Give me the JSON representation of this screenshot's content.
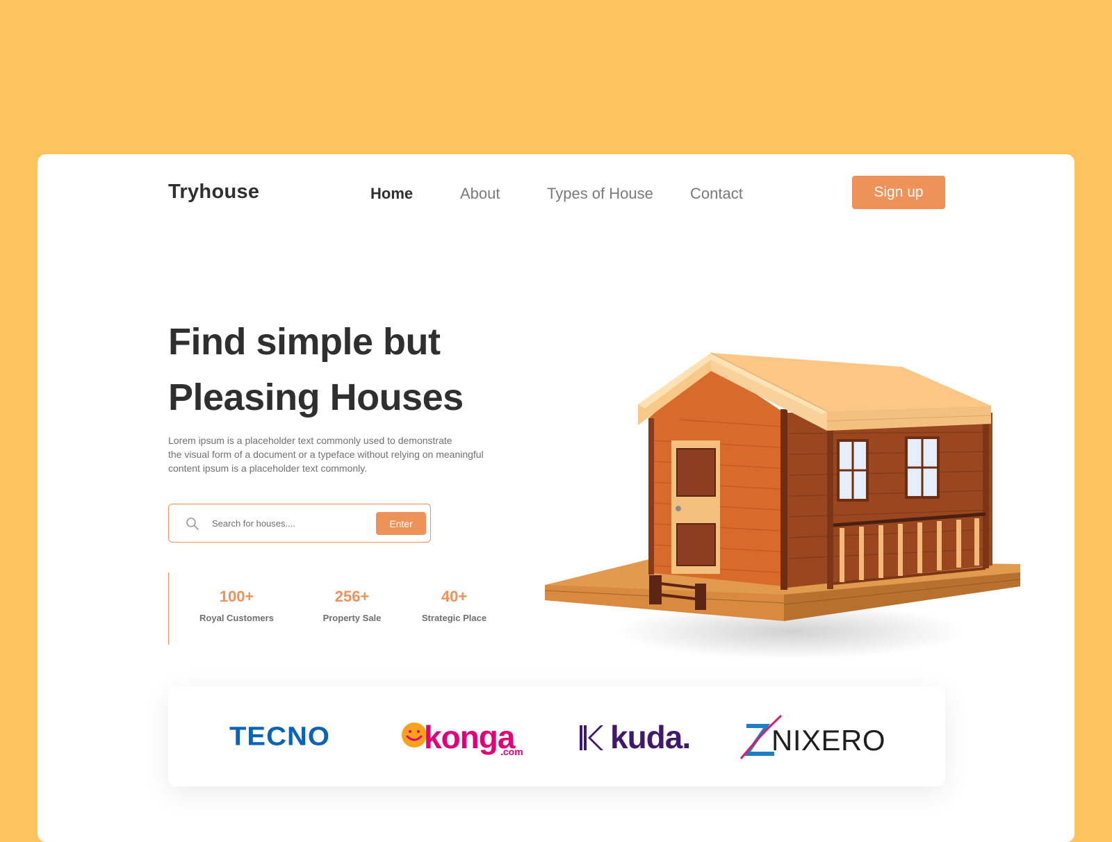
{
  "brand": "Tryhouse",
  "nav": {
    "items": [
      {
        "label": "Home",
        "active": true
      },
      {
        "label": "About",
        "active": false
      },
      {
        "label": "Types of House",
        "active": false
      },
      {
        "label": "Contact",
        "active": false
      }
    ],
    "signup_label": "Sign up"
  },
  "hero": {
    "headline_line1": "Find simple but",
    "headline_line2": "Pleasing Houses",
    "description_lines": [
      "Lorem ipsum is a placeholder text commonly used to demonstrate",
      "the visual form of a document or a typeface without relying on meaningful",
      "content ipsum is a placeholder text commonly."
    ],
    "search": {
      "icon": "search-icon",
      "placeholder": "Search for houses....",
      "value": "",
      "button_label": "Enter"
    },
    "stats": [
      {
        "value": "100+",
        "label": "Royal Customers"
      },
      {
        "value": "256+",
        "label": "Property Sale"
      },
      {
        "value": "40+",
        "label": "Strategic Place"
      }
    ]
  },
  "partners": {
    "tecno": "TECNO",
    "konga": "konga",
    "konga_suffix": ".com",
    "kuda": "kuda.",
    "nixero": "NIXERO"
  },
  "colors": {
    "background": "#FEC35E",
    "accent": "#EE925A",
    "text_dark": "#2f2f2f",
    "text_muted": "#7a7a7a"
  }
}
